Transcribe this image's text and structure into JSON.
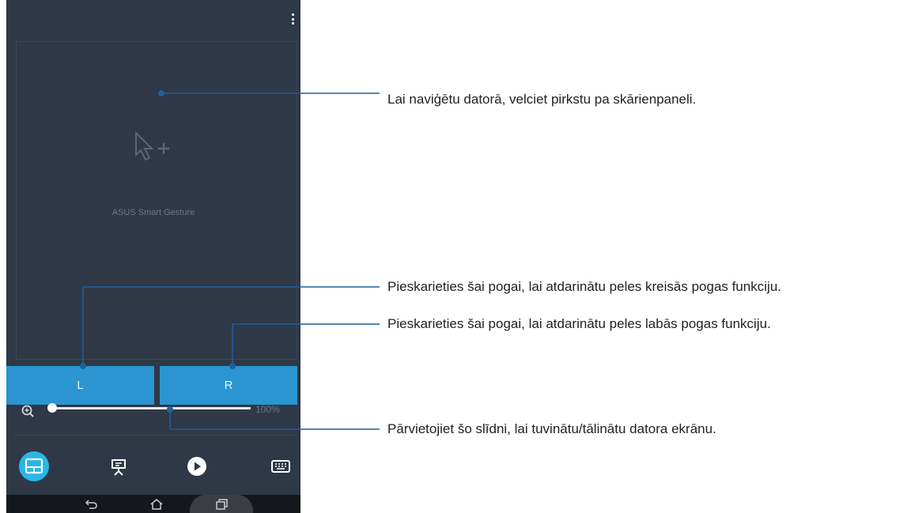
{
  "app": {
    "gesture_label": "ASUS Smart Gesture",
    "left_button": "L",
    "right_button": "R",
    "zoom_value": "100%",
    "zoom_level_percent": 100,
    "active_tab": "touchpad",
    "accent_color": "#2a95d0"
  },
  "tabs": [
    {
      "icon": "touchpad-icon",
      "active": true
    },
    {
      "icon": "presentation-icon",
      "active": false
    },
    {
      "icon": "play-icon",
      "active": false
    },
    {
      "icon": "keyboard-icon",
      "active": false
    }
  ],
  "navbar": {
    "icons": [
      "back-icon",
      "home-icon",
      "recent-apps-icon"
    ]
  },
  "callouts": {
    "touchpad": "Lai naviģētu datorā, velciet pirkstu pa skārienpaneli.",
    "left_button": "Pieskarieties šai pogai, lai atdarinātu peles kreisās pogas funkciju.",
    "right_button": "Pieskarieties šai pogai, lai atdarinātu peles labās pogas funkciju.",
    "slider": "Pārvietojiet šo slīdni, lai tuvinātu/tālinātu datora ekrānu."
  }
}
